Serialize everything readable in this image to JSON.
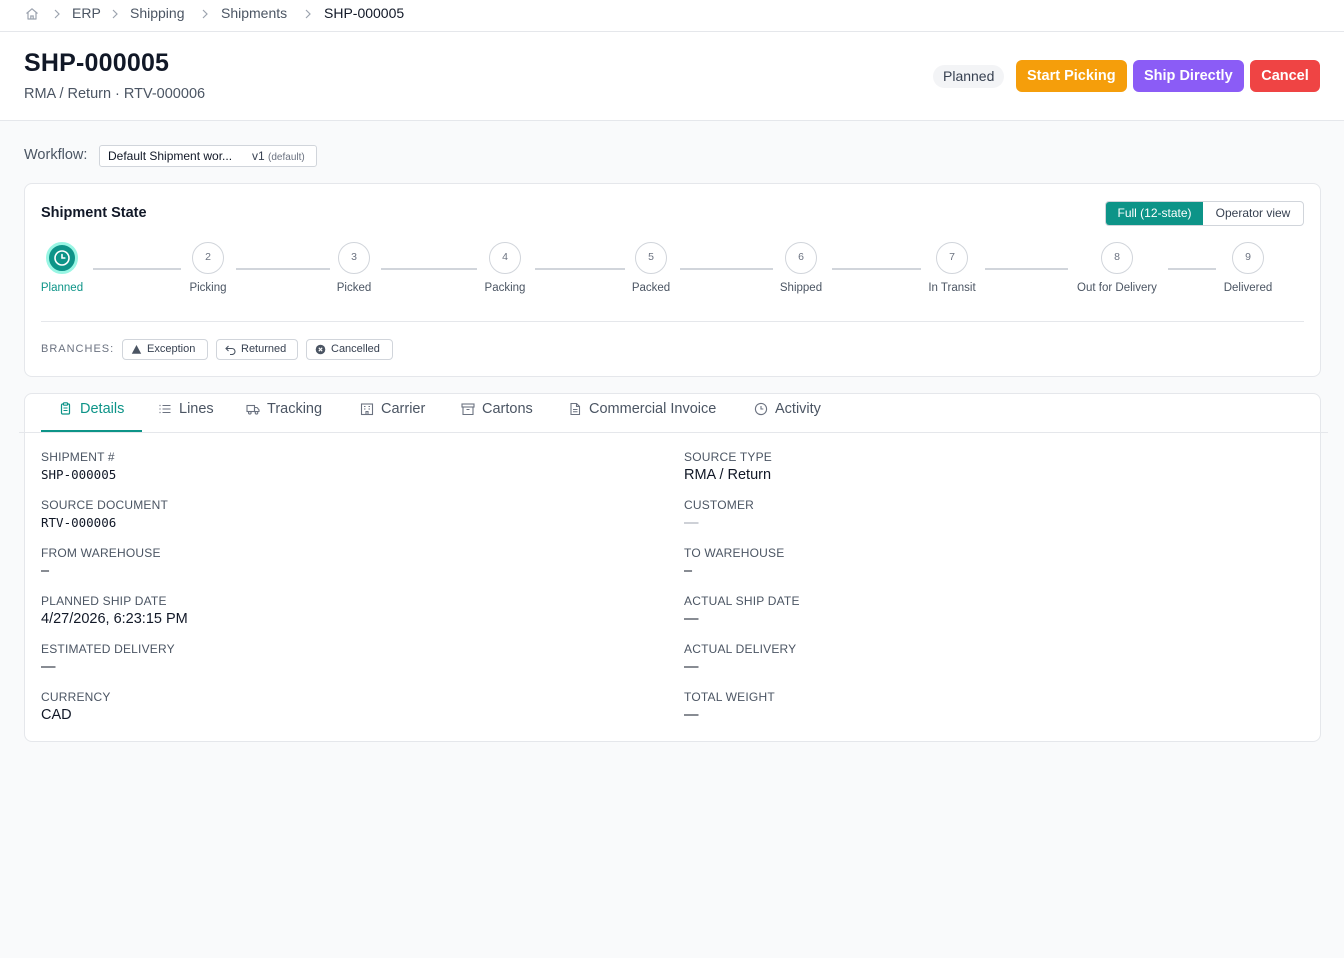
{
  "breadcrumb": {
    "items": [
      "ERP",
      "Shipping",
      "Shipments"
    ],
    "current": "SHP-000005"
  },
  "header": {
    "title": "SHP-000005",
    "subtitle": "RMA / Return · RTV-000006",
    "status": "Planned",
    "actions": {
      "start_picking": "Start Picking",
      "ship_directly": "Ship Directly",
      "cancel": "Cancel"
    }
  },
  "colors": {
    "accent": "#0d9488",
    "start_picking": "#f59e0b",
    "ship_directly": "#8b5cf6",
    "cancel": "#ef4444"
  },
  "workflow": {
    "label": "Workflow:",
    "name": "Default Shipment wor...",
    "version": "v1",
    "default_tag": "(default)"
  },
  "state": {
    "title": "Shipment State",
    "view_toggle": {
      "full": "Full (12-state)",
      "operator": "Operator view",
      "selected": "full"
    },
    "current_step": 1,
    "steps": [
      {
        "number": "1",
        "label": "Planned"
      },
      {
        "number": "2",
        "label": "Picking"
      },
      {
        "number": "3",
        "label": "Picked"
      },
      {
        "number": "4",
        "label": "Packing"
      },
      {
        "number": "5",
        "label": "Packed"
      },
      {
        "number": "6",
        "label": "Shipped"
      },
      {
        "number": "7",
        "label": "In Transit"
      },
      {
        "number": "8",
        "label": "Out for Delivery"
      },
      {
        "number": "9",
        "label": "Delivered"
      }
    ],
    "branches_label": "BRANCHES:",
    "branches": [
      {
        "label": "Exception",
        "icon": "warning-triangle-icon"
      },
      {
        "label": "Returned",
        "icon": "return-arrow-icon"
      },
      {
        "label": "Cancelled",
        "icon": "cancel-circle-icon"
      }
    ]
  },
  "tabs": [
    {
      "label": "Details",
      "icon": "document-icon",
      "active": true
    },
    {
      "label": "Lines",
      "icon": "list-icon",
      "active": false
    },
    {
      "label": "Tracking",
      "icon": "truck-icon",
      "active": false
    },
    {
      "label": "Carrier",
      "icon": "building-icon",
      "active": false
    },
    {
      "label": "Cartons",
      "icon": "box-icon",
      "active": false
    },
    {
      "label": "Commercial Invoice",
      "icon": "file-icon",
      "active": false
    },
    {
      "label": "Activity",
      "icon": "clock-icon",
      "active": false
    }
  ],
  "details": {
    "left": [
      {
        "label": "SHIPMENT #",
        "value": "SHP-000005"
      },
      {
        "label": "SOURCE DOCUMENT",
        "value": "RTV-000006"
      },
      {
        "label": "FROM WAREHOUSE",
        "value": "–"
      },
      {
        "label": "PLANNED SHIP DATE",
        "value": "4/27/2026, 6:23:15 PM"
      },
      {
        "label": "ESTIMATED DELIVERY",
        "value": "—"
      },
      {
        "label": "CURRENCY",
        "value": "CAD"
      }
    ],
    "right": [
      {
        "label": "SOURCE TYPE",
        "value": "RMA / Return"
      },
      {
        "label": "CUSTOMER",
        "value": "—"
      },
      {
        "label": "TO WAREHOUSE",
        "value": "–"
      },
      {
        "label": "ACTUAL SHIP DATE",
        "value": "—"
      },
      {
        "label": "ACTUAL DELIVERY",
        "value": "—"
      },
      {
        "label": "TOTAL WEIGHT",
        "value": "—"
      }
    ]
  }
}
